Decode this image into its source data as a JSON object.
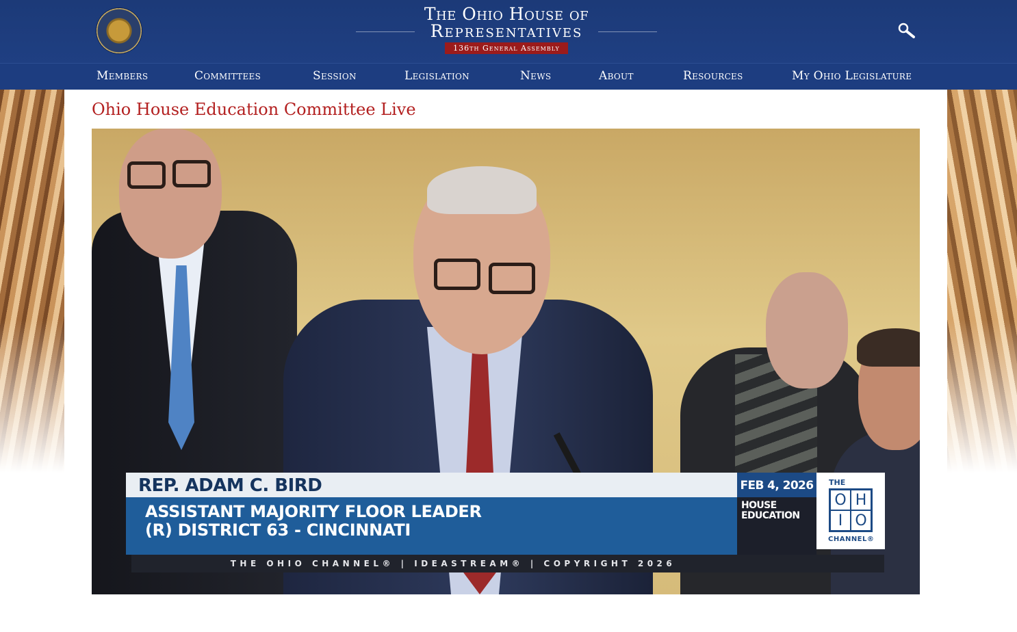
{
  "header": {
    "title_line1": "The Ohio House of",
    "title_line2": "Representatives",
    "assembly": "136th General Assembly",
    "seal_text": "The House of Representatives",
    "search_icon": "magnifier-icon"
  },
  "nav": {
    "items": [
      "Members",
      "Committees",
      "Session",
      "Legislation",
      "News",
      "About",
      "Resources",
      "My Ohio Legislature"
    ]
  },
  "page": {
    "title": "Ohio House Education Committee Live"
  },
  "video": {
    "lower_third": {
      "name": "REP. ADAM C. BIRD",
      "role_line1": "ASSISTANT MAJORITY FLOOR LEADER",
      "role_line2": "(R) DISTRICT 63 - CINCINNATI",
      "date": "FEB 4, 2026",
      "committee_line1": "HOUSE",
      "committee_line2": "EDUCATION",
      "footer": "THE OHIO CHANNEL® | IDEASTREAM® | COPYRIGHT 2026"
    },
    "logo": {
      "the": "THE",
      "letters": [
        "O",
        "H",
        "I",
        "O"
      ],
      "channel": "CHANNEL®"
    }
  },
  "colors": {
    "header_blue": "#1c3a78",
    "accent_red": "#b32020",
    "assembly_red": "#9b1b1b"
  }
}
